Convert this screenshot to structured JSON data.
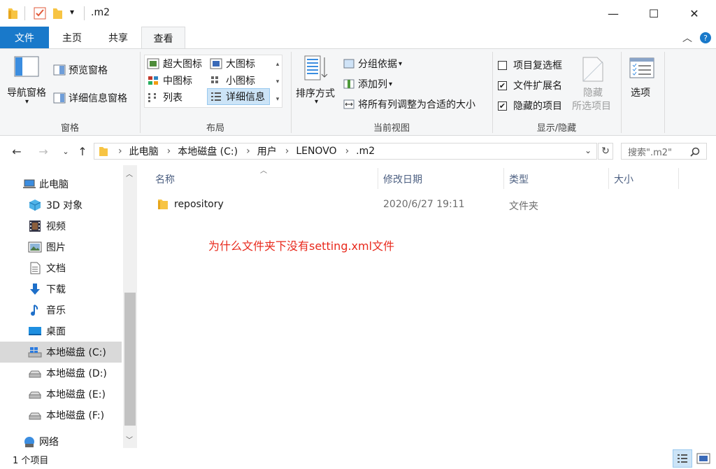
{
  "window": {
    "title": ".m2",
    "qat_dropdown": "▾",
    "minimize": "—",
    "maximize": "☐",
    "close": "✕"
  },
  "ribbon_tabs": [
    "文件",
    "主页",
    "共享",
    "查看"
  ],
  "ribbon": {
    "panes_group": {
      "label": "窗格",
      "nav_pane": "导航窗格",
      "preview_pane": "预览窗格",
      "details_pane": "详细信息窗格"
    },
    "layout_group": {
      "label": "布局",
      "items": [
        "超大图标",
        "大图标",
        "中图标",
        "小图标",
        "列表",
        "详细信息"
      ]
    },
    "current_view_group": {
      "label": "当前视图",
      "sort_by": "排序方式",
      "group_by": "分组依据",
      "add_columns": "添加列",
      "fit_columns": "将所有列调整为合适的大小"
    },
    "show_hide_group": {
      "label": "显示/隐藏",
      "item_checkboxes": "项目复选框",
      "file_extensions": "文件扩展名",
      "hidden_items": "隐藏的项目",
      "hide_selected_1": "隐藏",
      "hide_selected_2": "所选项目",
      "checkbox_states": [
        false,
        true,
        true
      ]
    },
    "options": {
      "label": "选项"
    }
  },
  "address": {
    "crumbs": [
      "此电脑",
      "本地磁盘 (C:)",
      "用户",
      "LENOVO",
      ".m2"
    ],
    "search_placeholder": "搜索\".m2\""
  },
  "nav_items": [
    {
      "label": "此电脑",
      "icon": "pc-icon"
    },
    {
      "label": "3D 对象",
      "icon": "cube-icon"
    },
    {
      "label": "视频",
      "icon": "film-icon"
    },
    {
      "label": "图片",
      "icon": "picture-icon"
    },
    {
      "label": "文档",
      "icon": "document-icon"
    },
    {
      "label": "下载",
      "icon": "download-icon"
    },
    {
      "label": "音乐",
      "icon": "music-icon"
    },
    {
      "label": "桌面",
      "icon": "desktop-icon"
    },
    {
      "label": "本地磁盘 (C:)",
      "icon": "windows-drive-icon",
      "selected": true
    },
    {
      "label": "本地磁盘 (D:)",
      "icon": "drive-icon"
    },
    {
      "label": "本地磁盘 (E:)",
      "icon": "drive-icon"
    },
    {
      "label": "本地磁盘 (F:)",
      "icon": "drive-icon"
    },
    {
      "label": "网络",
      "icon": "network-icon"
    }
  ],
  "columns": [
    "名称",
    "修改日期",
    "类型",
    "大小"
  ],
  "files": [
    {
      "name": "repository",
      "modified": "2020/6/27 19:11",
      "type": "文件夹",
      "size": ""
    }
  ],
  "annotation": "为什么文件夹下没有setting.xml文件",
  "status": {
    "count": "1 个项目"
  },
  "colors": {
    "file_tab": "#1979ca",
    "annotation": "#e8291c",
    "folder": "#f7c443",
    "header_text": "#4d6082"
  }
}
